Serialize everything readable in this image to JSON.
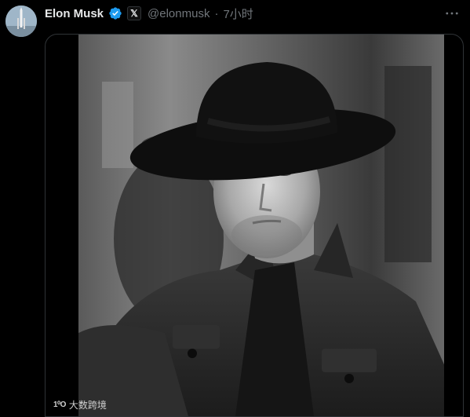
{
  "post": {
    "author_name": "Elon Musk",
    "handle": "@elonmusk",
    "separator": "·",
    "timestamp": "7小时",
    "x_badge": "𝕏",
    "more_icon": "ellipsis-icon",
    "verified_icon": "verified-badge-icon"
  },
  "watermark": {
    "logo": "1⁰O",
    "text": "大数跨境"
  },
  "colors": {
    "background": "#000000",
    "primary_text": "#e7e9ea",
    "secondary_text": "#71767b",
    "verified": "#1d9bf0",
    "border": "#2f3336"
  }
}
